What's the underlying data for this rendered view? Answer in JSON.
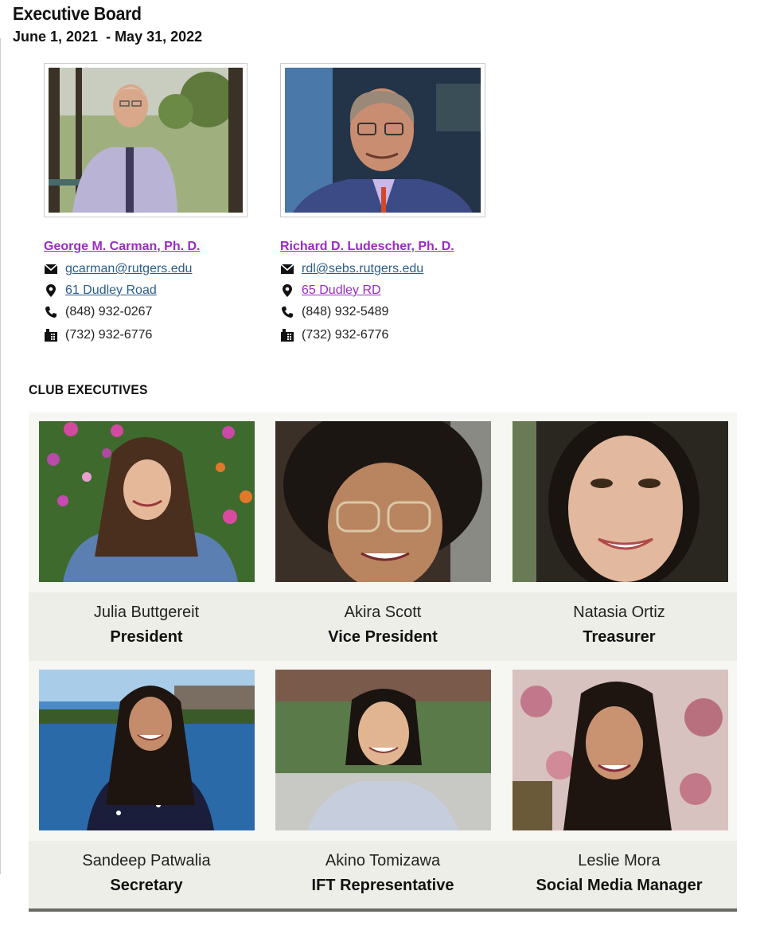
{
  "header": {
    "title": "Executive Board",
    "dates": "June 1, 2021  - May 31, 2022"
  },
  "advisors": [
    {
      "name": "George M. Carman, Ph. D.",
      "email": "gcarman@rutgers.edu",
      "address": "61 Dudley Road",
      "phone": "(848) 932-0267",
      "fax": "(732) 932-6776"
    },
    {
      "name": "Richard D. Ludescher, Ph. D.",
      "email": "rdl@sebs.rutgers.edu",
      "address": "65 Dudley RD",
      "phone": "(848) 932-5489",
      "fax": "(732) 932-6776"
    }
  ],
  "club_section": {
    "heading": "CLUB EXECUTIVES"
  },
  "executives": [
    {
      "name": "Julia Buttgereit",
      "role": "President"
    },
    {
      "name": "Akira Scott",
      "role": "Vice President"
    },
    {
      "name": "Natasia Ortiz",
      "role": "Treasurer"
    },
    {
      "name": "Sandeep Patwalia",
      "role": "Secretary"
    },
    {
      "name": "Akino Tomizawa",
      "role": "IFT Representative"
    },
    {
      "name": "Leslie Mora",
      "role": "Social Media Manager"
    }
  ],
  "icons": {
    "email": "envelope-icon",
    "address": "map-marker-icon",
    "phone": "phone-icon",
    "fax": "fax-icon"
  },
  "colors": {
    "link_visited": "#9b2bc4",
    "link": "#2a5d8a",
    "caption_band": "#eeeee8",
    "bottom_rule": "#6b6b63"
  }
}
